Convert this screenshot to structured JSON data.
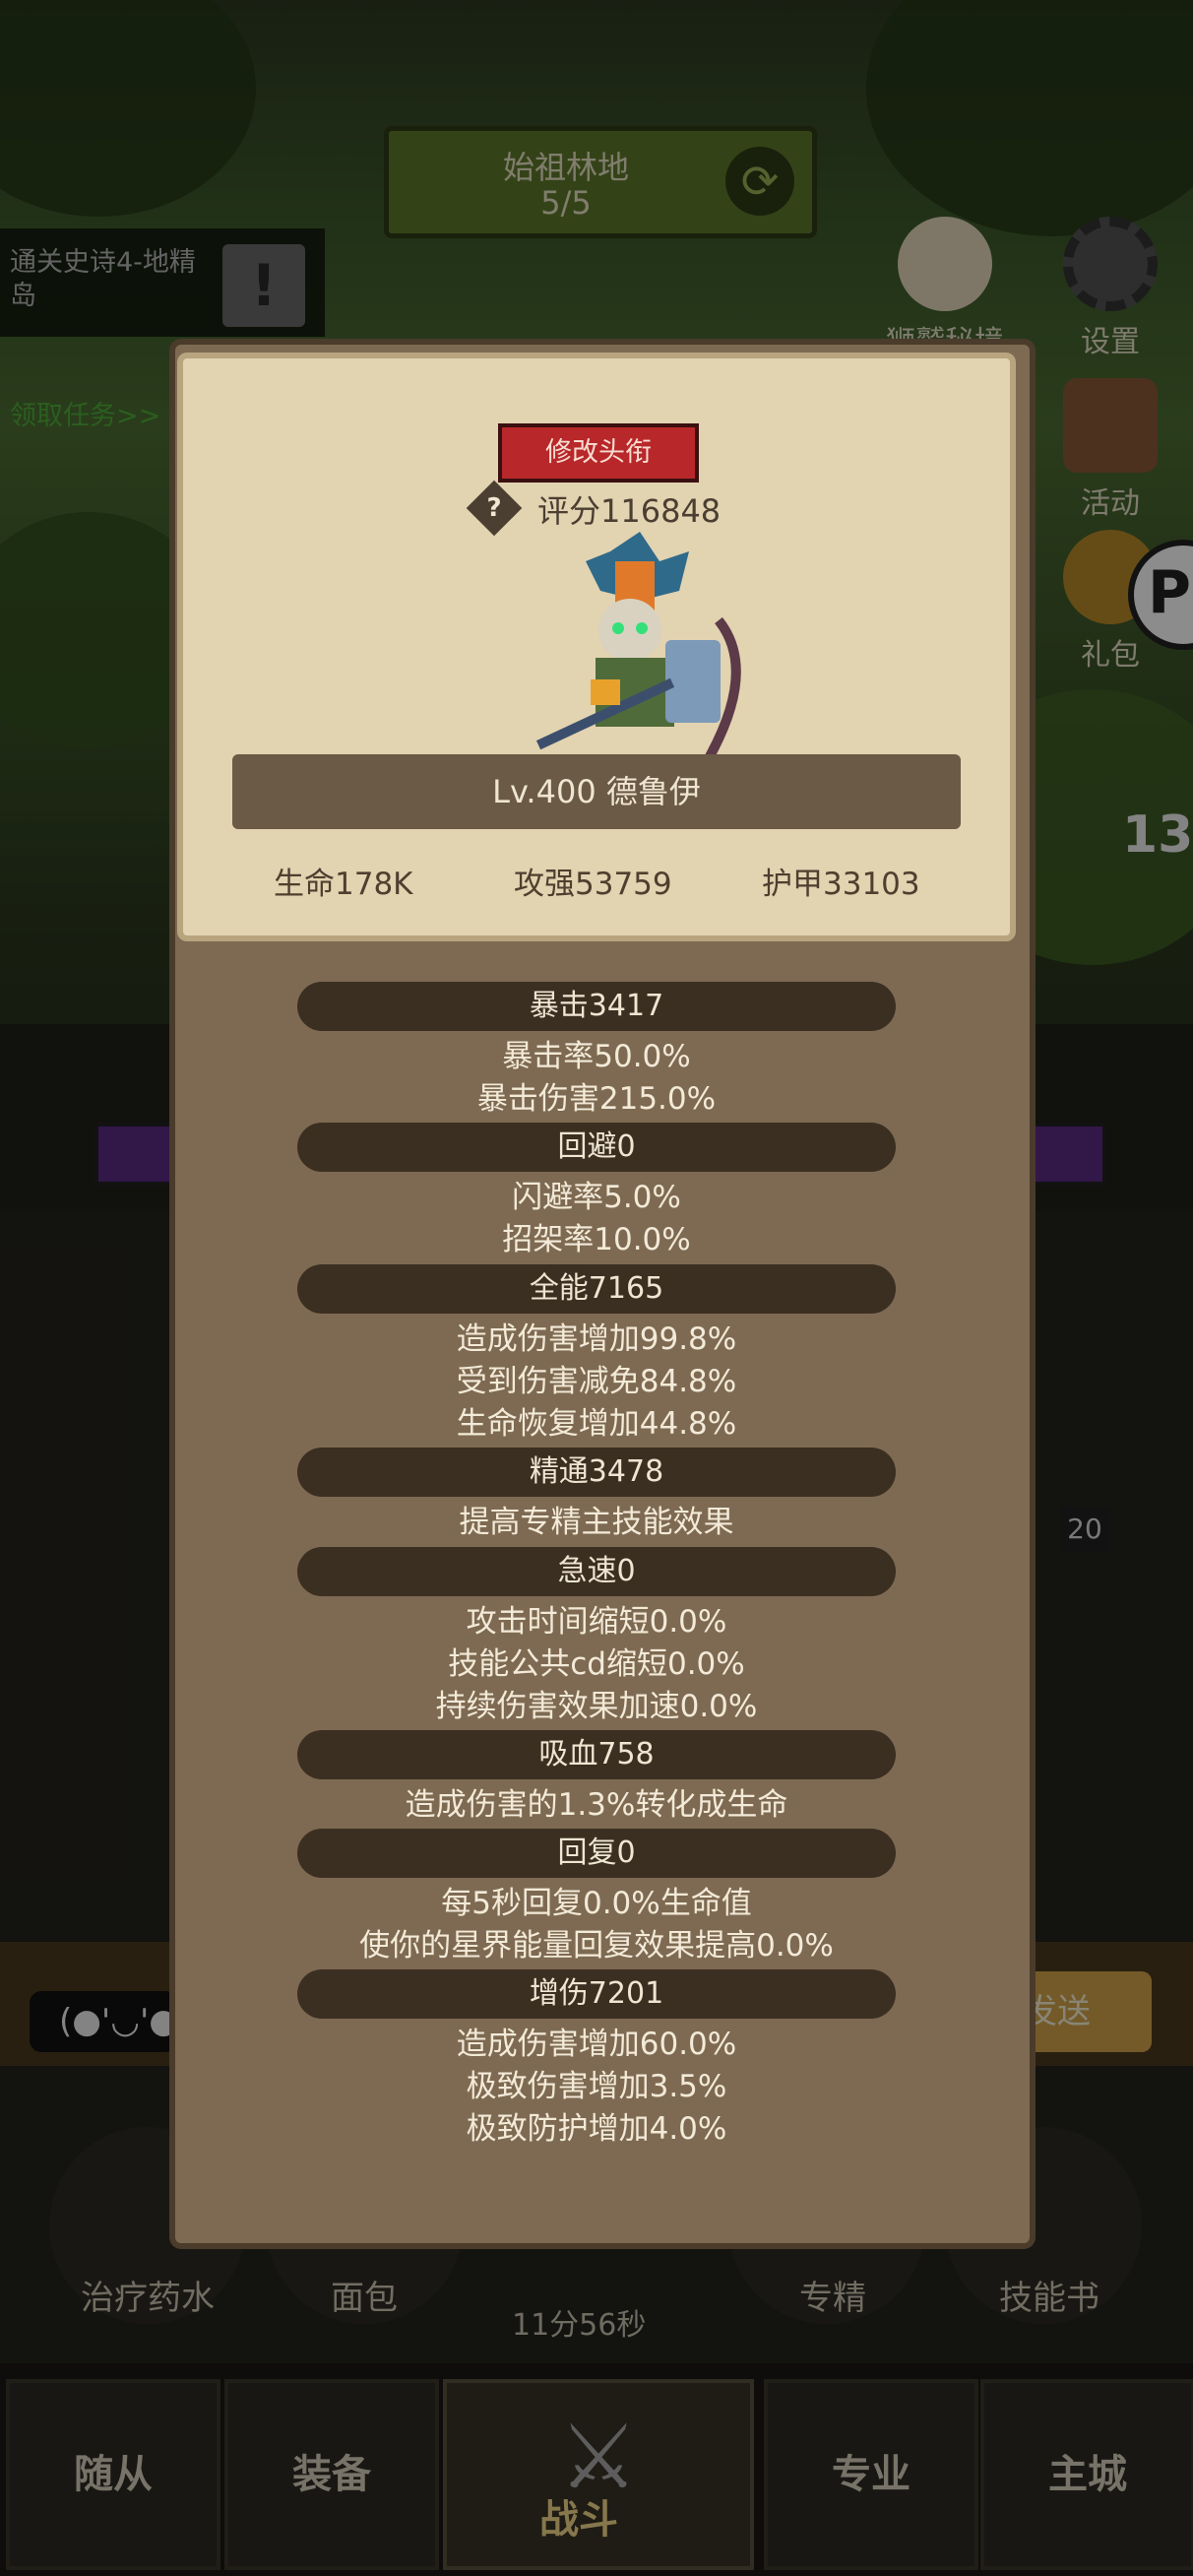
{
  "zone": {
    "name": "始祖林地",
    "progress": "5/5",
    "refresh_icon": "refresh-icon"
  },
  "quest": {
    "text": "通关史诗4-地精岛",
    "link": "领取任务>>"
  },
  "side_menu": {
    "secret_realm": "狮鹫秘境",
    "settings": "设置",
    "activity": "活动",
    "gift": "礼包",
    "pin_letter": "P",
    "number_partial": "13"
  },
  "background": {
    "chat_emote": "(●'◡'●",
    "send_label": "发送",
    "slot_badge": "20",
    "bottom_slots": [
      "治疗药水",
      "面包",
      "专精",
      "技能书"
    ],
    "timer": "11分56秒"
  },
  "nav": {
    "tabs": [
      "随从",
      "装备",
      "专业",
      "主城"
    ],
    "battle": "战斗"
  },
  "hero": {
    "title_button": "修改头衔",
    "score_label": "评分116848",
    "level_name": "Lv.400 德鲁伊",
    "hp": "生命178K",
    "attack": "攻强53759",
    "armor": "护甲33103"
  },
  "stats": [
    {
      "header": "暴击3417",
      "lines": [
        "暴击率50.0%",
        "暴击伤害215.0%"
      ]
    },
    {
      "header": "回避0",
      "lines": [
        "闪避率5.0%",
        "招架率10.0%"
      ]
    },
    {
      "header": "全能7165",
      "lines": [
        "造成伤害增加99.8%",
        "受到伤害减免84.8%",
        "生命恢复增加44.8%"
      ]
    },
    {
      "header": "精通3478",
      "lines": [
        "提高专精主技能效果"
      ]
    },
    {
      "header": "急速0",
      "lines": [
        "攻击时间缩短0.0%",
        "技能公共cd缩短0.0%",
        "持续伤害效果加速0.0%"
      ]
    },
    {
      "header": "吸血758",
      "lines": [
        "造成伤害的1.3%转化成生命"
      ]
    },
    {
      "header": "回复0",
      "lines": [
        "每5秒回复0.0%生命值",
        "使你的星界能量回复效果提高0.0%"
      ]
    },
    {
      "header": "增伤7201",
      "lines": [
        "造成伤害增加60.0%",
        "极致伤害增加3.5%",
        "极致防护增加4.0%"
      ]
    }
  ]
}
